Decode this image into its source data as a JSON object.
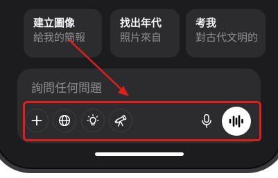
{
  "suggestions": [
    {
      "title": "建立圖像",
      "subtitle": "給我的簡報"
    },
    {
      "title": "找出年代",
      "subtitle": "照片來自"
    },
    {
      "title": "考我",
      "subtitle": "對古代文明的"
    }
  ],
  "composer": {
    "placeholder": "詢問任何問題"
  },
  "toolbar": {
    "buttons": [
      "plus-icon",
      "globe-icon",
      "lightbulb-icon",
      "telescope-icon",
      "microphone-icon",
      "voice-waveform-icon"
    ]
  },
  "colors": {
    "background": "#1c1c1e",
    "card": "#2c2c2e",
    "annotation": "#e01e1e",
    "text": "#f2f2f7",
    "muted": "#8e8e93"
  }
}
